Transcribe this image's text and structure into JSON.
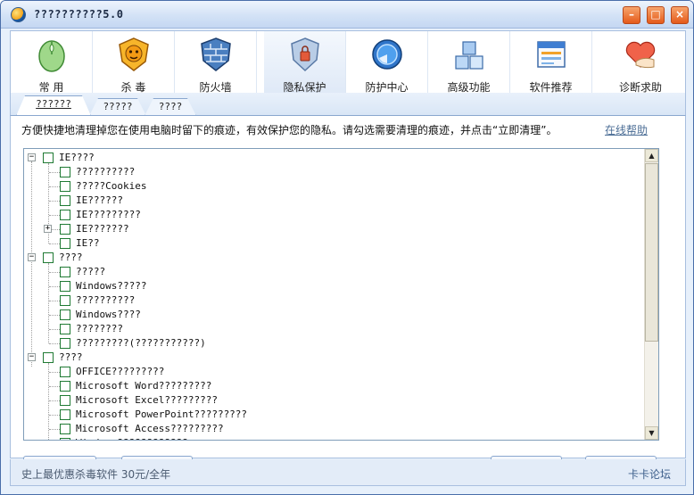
{
  "window": {
    "title": "??????????5.0"
  },
  "toolbar": {
    "items": [
      {
        "label": "常 用",
        "icon": "mouse-icon"
      },
      {
        "label": "杀 毒",
        "icon": "lion-shield-icon"
      },
      {
        "label": "防火墙",
        "icon": "firewall-icon"
      },
      {
        "label": "隐私保护",
        "icon": "privacy-shield-icon"
      },
      {
        "label": "防护中心",
        "icon": "protection-center-icon"
      },
      {
        "label": "高级功能",
        "icon": "cubes-icon"
      },
      {
        "label": "软件推荐",
        "icon": "software-window-icon"
      },
      {
        "label": "诊断求助",
        "icon": "heart-hand-icon"
      }
    ],
    "active": "隐私保护"
  },
  "tabs": [
    "??????",
    "?????",
    "????"
  ],
  "content": {
    "description": "方便快捷地清理掉您在使用电脑时留下的痕迹，有效保护您的隐私。请勾选需要清理的痕迹，并点击“立即清理”。",
    "help_link": "在线帮助"
  },
  "tree": {
    "groups": [
      {
        "label": "IE????",
        "expanded": true,
        "items": [
          {
            "label": "??????????"
          },
          {
            "label": "?????Cookies"
          },
          {
            "label": "IE??????"
          },
          {
            "label": "IE?????????"
          },
          {
            "label": "IE???????",
            "collapsed_child": true
          },
          {
            "label": "IE??"
          }
        ]
      },
      {
        "label": "????",
        "expanded": true,
        "items": [
          {
            "label": "?????"
          },
          {
            "label": "Windows?????"
          },
          {
            "label": "??????????"
          },
          {
            "label": "Windows????"
          },
          {
            "label": "????????"
          },
          {
            "label": "?????????(???????????)"
          }
        ]
      },
      {
        "label": "????",
        "expanded": true,
        "items": [
          {
            "label": "OFFICE?????????"
          },
          {
            "label": "Microsoft Word?????????"
          },
          {
            "label": "Microsoft Excel?????????"
          },
          {
            "label": "Microsoft PowerPoint?????????"
          },
          {
            "label": "Microsoft Access?????????"
          },
          {
            "label": "Windows????????????"
          }
        ]
      }
    ]
  },
  "statusbar": {
    "left": "史上最优惠杀毒软件 30元/全年",
    "right": "卡卡论坛"
  },
  "colors": {
    "accent": "#4a6ea9",
    "checkbox_border": "#1f7a33",
    "link": "#4c6e96"
  }
}
